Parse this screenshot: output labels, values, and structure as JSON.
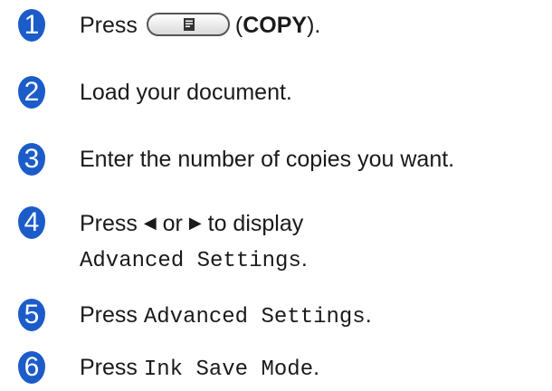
{
  "steps": [
    {
      "number": "1",
      "before": "Press",
      "after_open": "(",
      "bold": "COPY",
      "after_close": ")."
    },
    {
      "number": "2",
      "text": "Load your document."
    },
    {
      "number": "3",
      "text": "Enter the number of copies you want."
    },
    {
      "number": "4",
      "before": "Press",
      "left_arrow": "◀",
      "or": "or",
      "right_arrow": "▶",
      "after": "to display",
      "mono": "Advanced Settings",
      "end": "."
    },
    {
      "number": "5",
      "before": "Press",
      "mono": "Advanced Settings",
      "end": "."
    },
    {
      "number": "6",
      "before": "Press",
      "mono": "Ink Save Mode",
      "end": "."
    }
  ],
  "colors": {
    "number_badge": "#1c5cc9",
    "text": "#1a1a1a"
  },
  "icons": {
    "copy_button": "copy-document-icon"
  }
}
